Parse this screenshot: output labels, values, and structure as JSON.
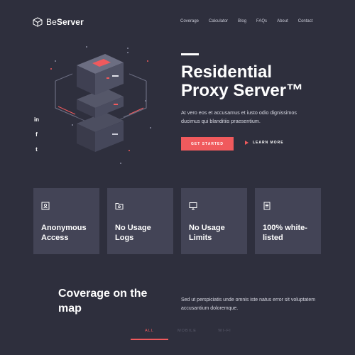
{
  "brand": {
    "name_light": "Be",
    "name_bold": "Server"
  },
  "nav": {
    "items": [
      "Coverage",
      "Calculator",
      "Blog",
      "FAQs",
      "About",
      "Contact"
    ]
  },
  "social": {
    "icons": [
      "linkedin-icon",
      "facebook-icon",
      "twitter-icon"
    ],
    "glyphs": [
      "in",
      "f",
      "t"
    ]
  },
  "hero": {
    "title_line1": "Residential",
    "title_line2": "Proxy Server™",
    "description": "At vero eos et accusamus et iusto odio dignissimos ducimus qui blanditiis praesentium.",
    "primary_button": "GET STARTED",
    "secondary_button": "LEARN MORE"
  },
  "features": [
    {
      "icon": "id-card-icon",
      "label": "Anonymous Access"
    },
    {
      "icon": "folder-settings-icon",
      "label": "No Usage Logs"
    },
    {
      "icon": "monitor-icon",
      "label": "No Usage Limits"
    },
    {
      "icon": "document-list-icon",
      "label": "100% white-listed"
    }
  ],
  "coverage": {
    "title": "Coverage on the map",
    "description": "Sed ut perspiciatis unde omnis iste natus error sit voluptatem accusantium doloremque.",
    "tabs": [
      "ALL",
      "MOBILE",
      "WI-FI"
    ],
    "active_tab": "ALL"
  },
  "colors": {
    "background": "#2e2f3d",
    "card": "#434456",
    "accent": "#f05a5d",
    "text": "#ffffff"
  }
}
